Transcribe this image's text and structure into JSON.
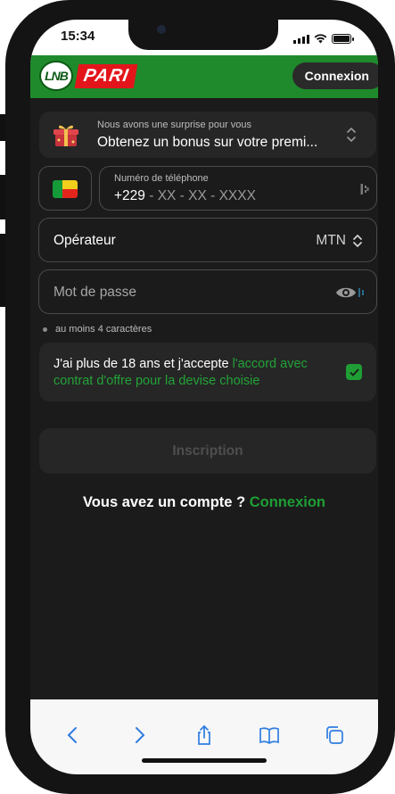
{
  "status": {
    "time": "15:34"
  },
  "header": {
    "logo_text": "PARI",
    "logo_emblem": "LNB",
    "login_label": "Connexion"
  },
  "promo": {
    "small": "Nous avons une surprise pour vous",
    "big": "Obtenez un bonus sur votre premi...",
    "icon": "gift-icon"
  },
  "country": {
    "flag": "Benin"
  },
  "phone": {
    "label": "Numéro de téléphone",
    "code": "+229",
    "mask": " - XX - XX - XXXX"
  },
  "operator": {
    "label": "Opérateur",
    "value": "MTN"
  },
  "password": {
    "placeholder": "Mot de passe"
  },
  "hint": {
    "text": "au moins 4 caractères"
  },
  "terms": {
    "text": "J'ai plus de 18 ans et j'accepte ",
    "link": "l'accord avec contrat d'offre pour la devise choisie",
    "checked": true
  },
  "submit": {
    "label": "Inscription"
  },
  "account": {
    "question": "Vous avez un compte ? ",
    "link": "Connexion"
  },
  "colors": {
    "brand_green": "#1f8a2b",
    "accent_green": "#1f9e35",
    "brand_red": "#e3151b",
    "background": "#1b1b1b"
  }
}
